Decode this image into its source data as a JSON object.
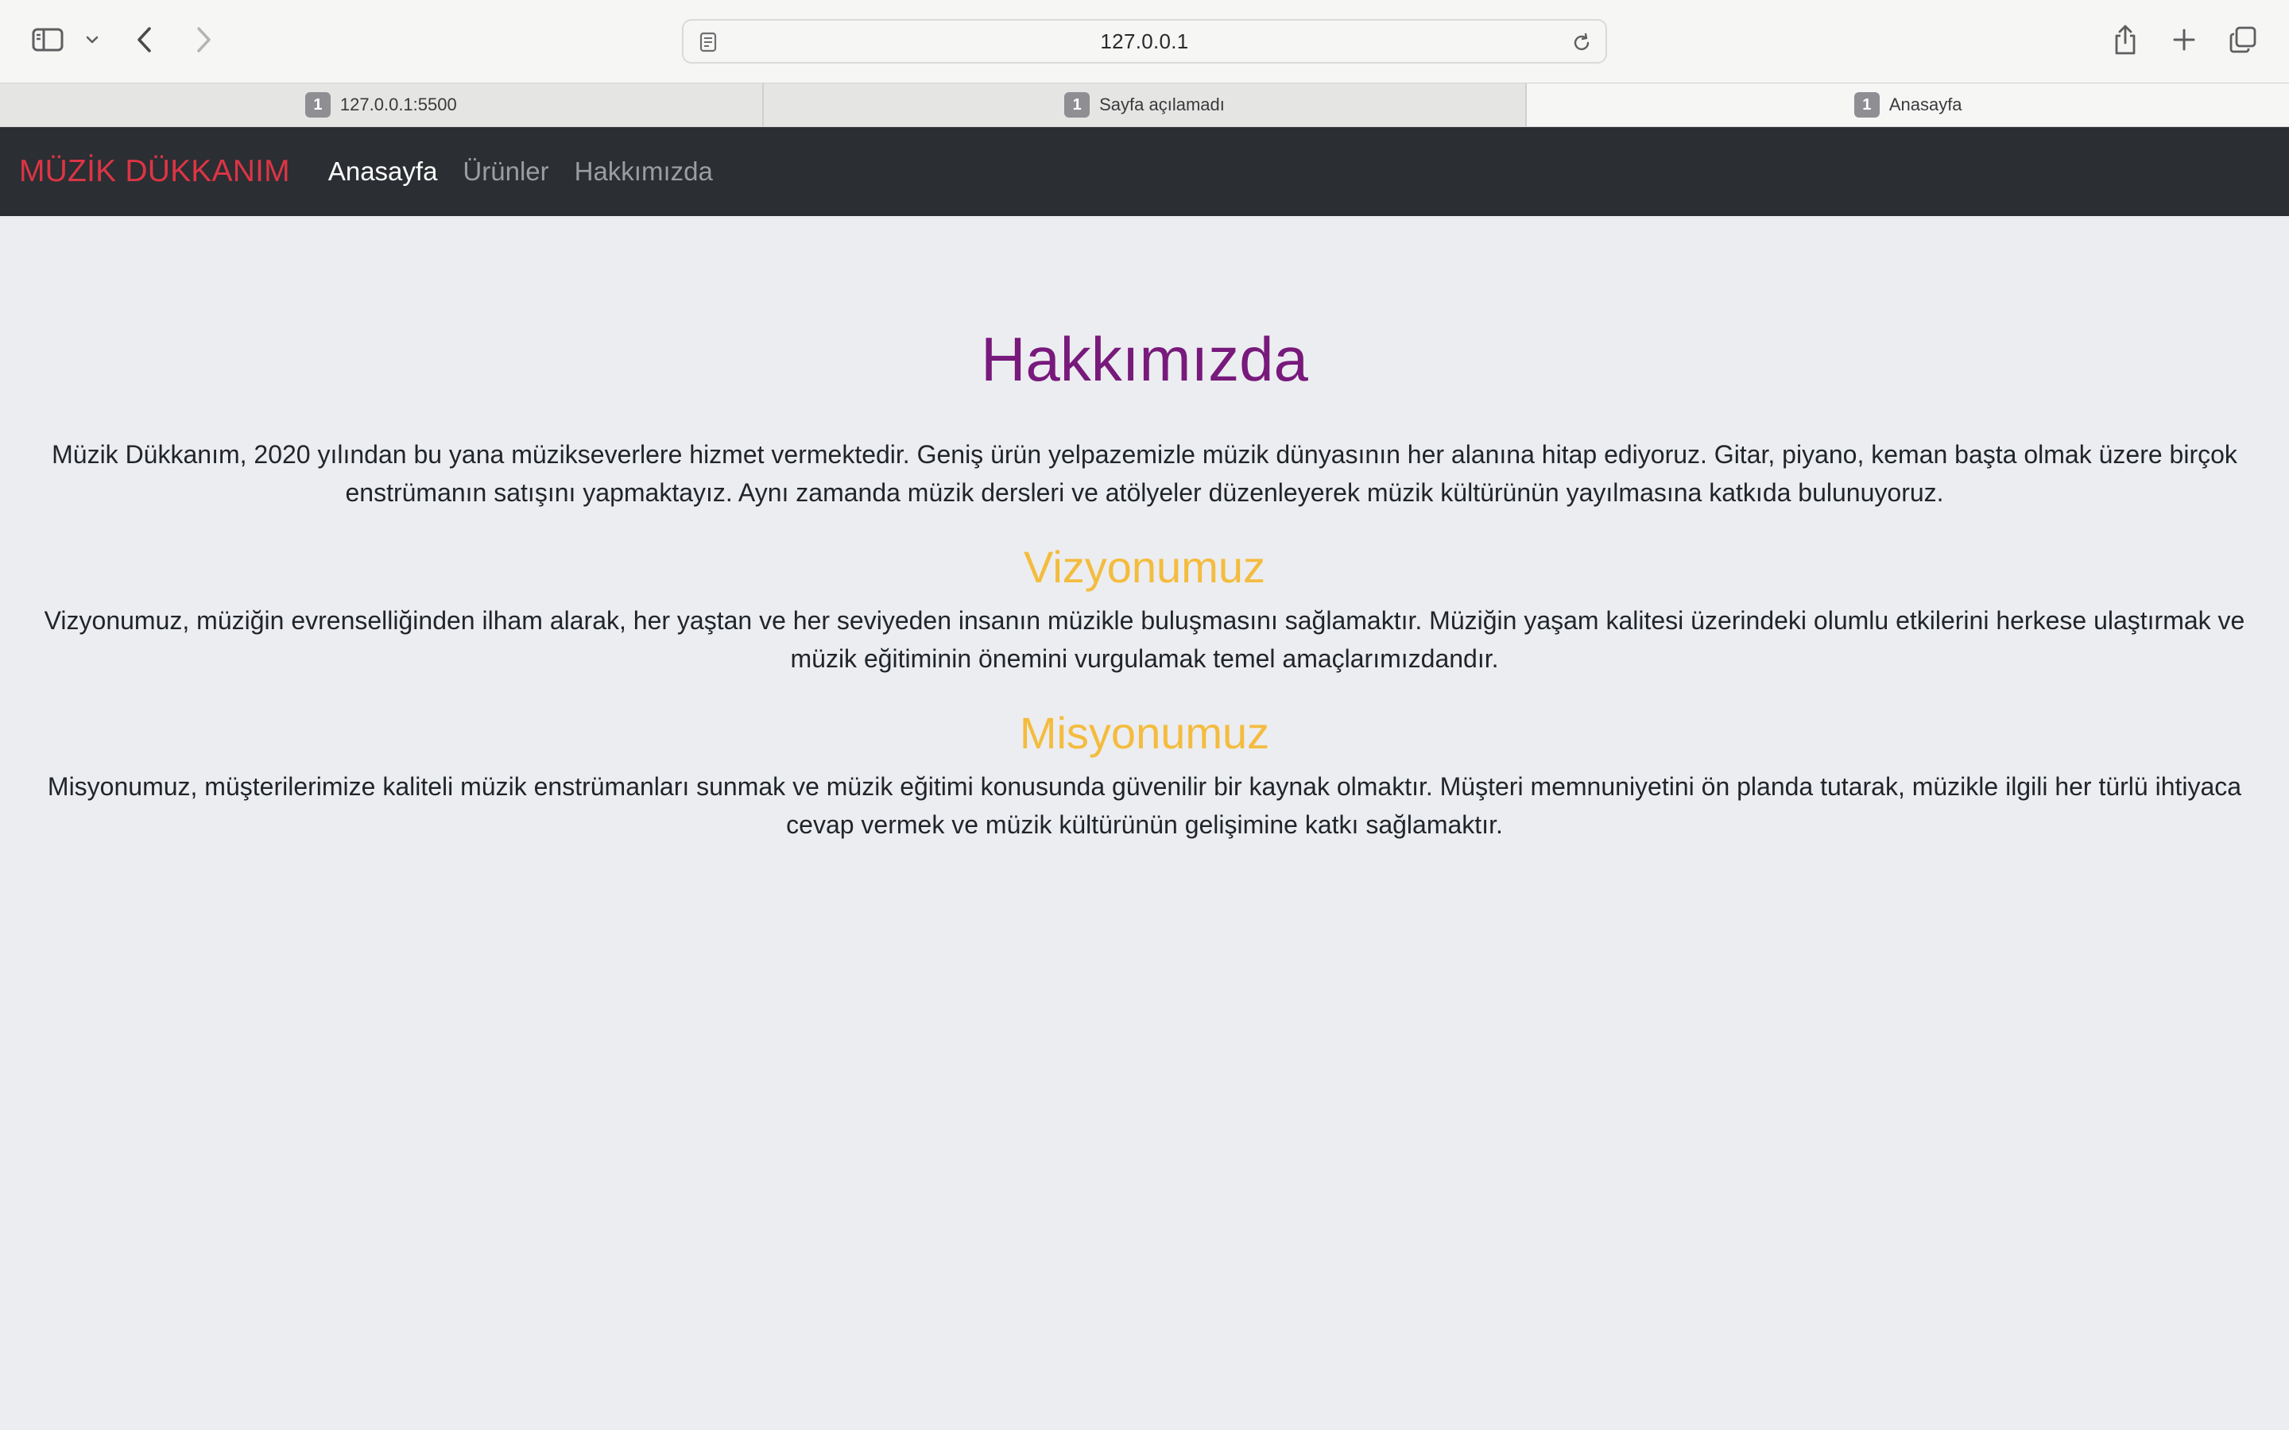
{
  "browser": {
    "address": "127.0.0.1",
    "tabs": [
      {
        "badge": "1",
        "label": "127.0.0.1:5500",
        "active": false
      },
      {
        "badge": "1",
        "label": "Sayfa açılamadı",
        "active": false
      },
      {
        "badge": "1",
        "label": "Anasayfa",
        "active": true
      }
    ]
  },
  "navbar": {
    "brand": "MÜZİK DÜKKANIM",
    "links": [
      {
        "label": "Anasayfa",
        "active": true
      },
      {
        "label": "Ürünler",
        "active": false
      },
      {
        "label": "Hakkımızda",
        "active": false
      }
    ]
  },
  "content": {
    "title": "Hakkımızda",
    "intro": "Müzik Dükkanım, 2020 yılından bu yana müzikseverlere hizmet vermektedir. Geniş ürün yelpazemizle müzik dünyasının her alanına hitap ediyoruz. Gitar, piyano, keman başta olmak üzere birçok enstrümanın satışını yapmaktayız. Aynı zamanda müzik dersleri ve atölyeler düzenleyerek müzik kültürünün yayılmasına katkıda bulunuyoruz.",
    "vision": {
      "heading": "Vizyonumuz",
      "text": "Vizyonumuz, müziğin evrenselliğinden ilham alarak, her yaştan ve her seviyeden insanın müzikle buluşmasını sağlamaktır. Müziğin yaşam kalitesi üzerindeki olumlu etkilerini herkese ulaştırmak ve müzik eğitiminin önemini vurgulamak temel amaçlarımızdandır."
    },
    "mission": {
      "heading": "Misyonumuz",
      "text": "Misyonumuz, müşterilerimize kaliteli müzik enstrümanları sunmak ve müzik eğitimi konusunda güvenilir bir kaynak olmaktır. Müşteri memnuniyetini ön planda tutarak, müzikle ilgili her türlü ihtiyaca cevap vermek ve müzik kültürünün gelişimine katkı sağlamaktır."
    }
  },
  "colors": {
    "navbar_bg": "#2B2E33",
    "brand": "#DC3545",
    "title": "#78197C",
    "section_heading": "#F4BC3E",
    "page_bg": "#ECEDF0"
  },
  "icons": {
    "sidebar": "sidebar-icon",
    "sidebar_menu": "chevron-down-icon",
    "back": "chevron-left-icon",
    "forward": "chevron-right-icon",
    "page": "page-icon",
    "reload": "reload-icon",
    "share": "share-icon",
    "new_tab": "plus-icon",
    "tab_overview": "tabs-overview-icon"
  }
}
